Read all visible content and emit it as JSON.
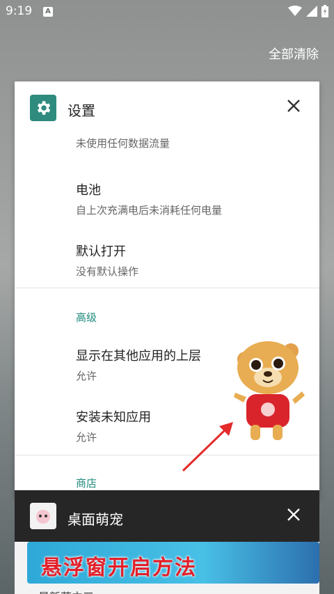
{
  "status_bar": {
    "time": "9:19",
    "notification_icon": "A"
  },
  "recents": {
    "clear_all": "全部清除"
  },
  "settings_card": {
    "app_name": "设置",
    "items": [
      {
        "subtitle": "未使用任何数据流量"
      },
      {
        "title": "电池",
        "subtitle": "自上次充满电后未消耗任何电量"
      },
      {
        "title": "默认打开",
        "subtitle": "没有默认操作"
      }
    ],
    "section_advanced": "高级",
    "advanced_items": [
      {
        "title": "显示在其他应用的上层",
        "subtitle": "允许"
      },
      {
        "title": "安装未知应用",
        "subtitle": "允许"
      }
    ],
    "section_store": "商店"
  },
  "pet_card": {
    "app_name": "桌面萌宠",
    "banner_text": "悬浮窗开启方法",
    "bottom_partial": "最新获中三"
  },
  "colors": {
    "accent": "#1f8a7c",
    "settings_icon_bg": "#2e8b7e"
  }
}
